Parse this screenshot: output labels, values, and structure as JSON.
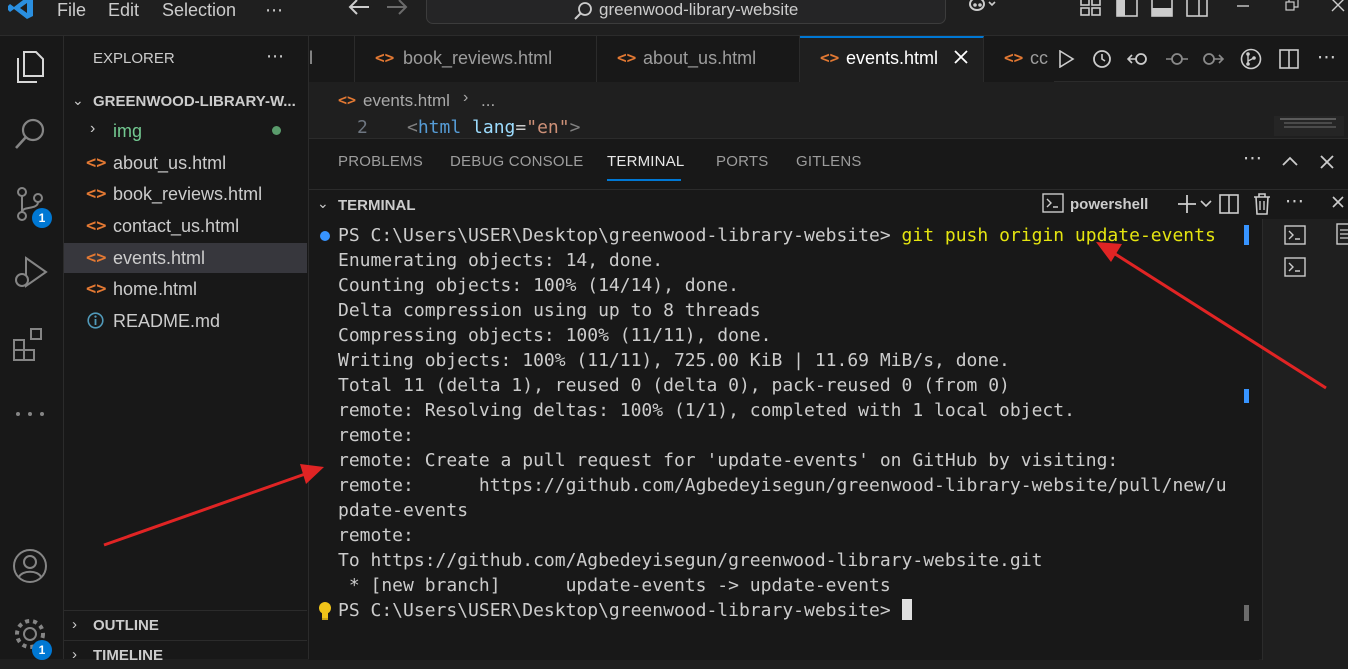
{
  "window": {
    "menu": [
      "File",
      "Edit",
      "Selection",
      "⋯"
    ],
    "search_text": "greenwood-library-website"
  },
  "activity": {
    "source_control_badge": "1",
    "settings_badge": "1"
  },
  "explorer": {
    "title": "EXPLORER",
    "root": "GREENWOOD-LIBRARY-W...",
    "items": [
      {
        "icon": "folder",
        "label": "img"
      },
      {
        "icon": "html",
        "label": "about_us.html"
      },
      {
        "icon": "html",
        "label": "book_reviews.html"
      },
      {
        "icon": "html",
        "label": "contact_us.html"
      },
      {
        "icon": "html",
        "label": "events.html"
      },
      {
        "icon": "html",
        "label": "home.html"
      },
      {
        "icon": "info",
        "label": "README.md"
      }
    ],
    "outline": "OUTLINE",
    "timeline": "TIMELINE"
  },
  "tabs": [
    {
      "label": "l"
    },
    {
      "label": "book_reviews.html"
    },
    {
      "label": "about_us.html"
    },
    {
      "label": "events.html"
    },
    {
      "label": "cc"
    }
  ],
  "editor": {
    "breadcrumb_file": "events.html",
    "breadcrumb_more": "...",
    "line_number": "2",
    "code_open": "<",
    "code_tag": "html",
    "code_attr": "lang",
    "code_eq": "=",
    "code_value": "\"en\"",
    "code_close": ">"
  },
  "panel": {
    "tabs": [
      "PROBLEMS",
      "DEBUG CONSOLE",
      "TERMINAL",
      "PORTS",
      "GITLENS"
    ],
    "section": "TERMINAL",
    "shell": "powershell"
  },
  "terminal": {
    "prompt": "PS C:\\Users\\USER\\Desktop\\greenwood-library-website>",
    "command": "git push origin update-events",
    "lines": [
      "Enumerating objects: 14, done.",
      "Counting objects: 100% (14/14), done.",
      "Delta compression using up to 8 threads",
      "Compressing objects: 100% (11/11), done.",
      "Writing objects: 100% (11/11), 725.00 KiB | 11.69 MiB/s, done.",
      "Total 11 (delta 1), reused 0 (delta 0), pack-reused 0 (from 0)",
      "remote: Resolving deltas: 100% (1/1), completed with 1 local object.",
      "remote:",
      "remote: Create a pull request for 'update-events' on GitHub by visiting:",
      "remote:      https://github.com/Agbedeyisegun/greenwood-library-website/pull/new/u",
      "pdate-events",
      "remote:",
      "To https://github.com/Agbedeyisegun/greenwood-library-website.git",
      " * [new branch]      update-events -> update-events"
    ],
    "final_prompt": "PS C:\\Users\\USER\\Desktop\\greenwood-library-website>"
  },
  "colors": {
    "accent": "#0078d4",
    "arrow": "#e02424",
    "command": "#e5e510",
    "html_icon": "#e37933"
  }
}
